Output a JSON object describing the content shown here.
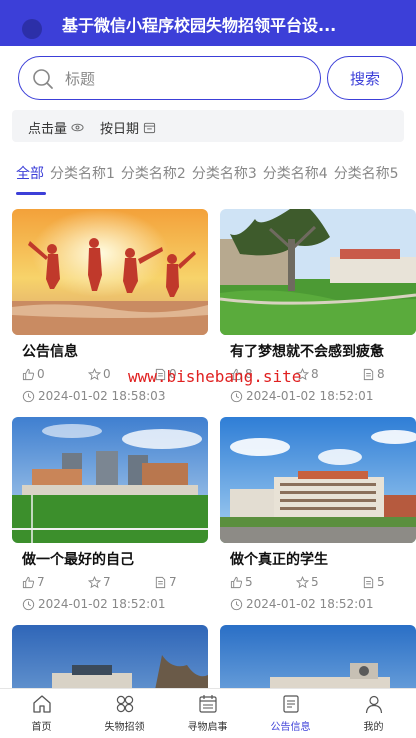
{
  "header": {
    "title": "基于微信小程序校园失物招领平台设..."
  },
  "search": {
    "placeholder": "标题",
    "button_label": "搜索"
  },
  "sort": {
    "by_clicks": "点击量",
    "by_date": "按日期"
  },
  "tabs": [
    "全部",
    "分类名称1",
    "分类名称2",
    "分类名称3",
    "分类名称4",
    "分类名称5"
  ],
  "cards": [
    {
      "title": "公告信息",
      "likes": "0",
      "favorites": "0",
      "comments": "0",
      "date": "2024-01-02 18:58:03"
    },
    {
      "title": "有了梦想就不会感到疲惫",
      "likes": "8",
      "favorites": "8",
      "comments": "8",
      "date": "2024-01-02 18:52:01"
    },
    {
      "title": "做一个最好的自己",
      "likes": "7",
      "favorites": "7",
      "comments": "7",
      "date": "2024-01-02 18:52:01"
    },
    {
      "title": "做个真正的学生",
      "likes": "5",
      "favorites": "5",
      "comments": "5",
      "date": "2024-01-02 18:52:01"
    }
  ],
  "watermark": "www.bishebang.site",
  "nav": [
    {
      "label": "首页",
      "icon": "home-icon"
    },
    {
      "label": "失物招领",
      "icon": "grid-icon"
    },
    {
      "label": "寻物启事",
      "icon": "calendar-icon"
    },
    {
      "label": "公告信息",
      "icon": "document-icon"
    },
    {
      "label": "我的",
      "icon": "user-icon"
    }
  ],
  "colors": {
    "primary": "#3c3fd8",
    "text_muted": "#888888",
    "watermark": "#e02020"
  }
}
